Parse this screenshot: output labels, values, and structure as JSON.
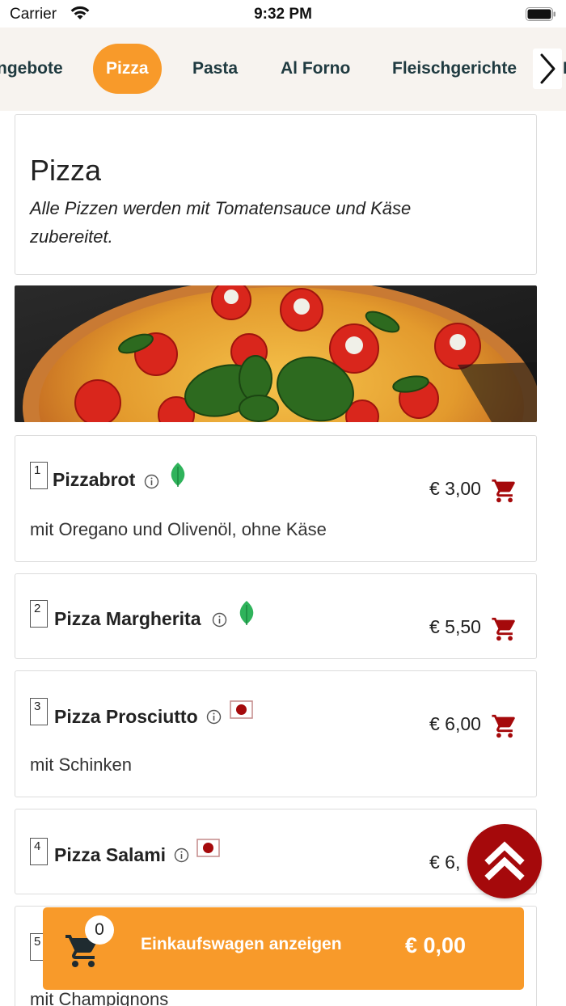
{
  "status_bar": {
    "carrier": "Carrier",
    "time": "9:32 PM"
  },
  "categories": [
    "ngebote",
    "Pizza",
    "Pasta",
    "Al Forno",
    "Fleischgerichte"
  ],
  "category_peek": "I",
  "active_category": "Pizza",
  "section": {
    "title": "Pizza",
    "description": "Alle Pizzen werden mit Tomatensauce und Käse zubereitet."
  },
  "items": [
    {
      "number": "1",
      "name": "Pizzabrot",
      "price": "€ 3,00",
      "description": "mit Oregano und Olivenöl, ohne Käse",
      "badge": "vegetarian-leaf-icon"
    },
    {
      "number": "2",
      "name": "Pizza Margherita",
      "price": "€ 5,50",
      "description": "",
      "badge": "vegetarian-leaf-icon"
    },
    {
      "number": "3",
      "name": "Pizza Prosciutto",
      "price": "€ 6,00",
      "description": "mit Schinken",
      "badge": "meat-icon"
    },
    {
      "number": "4",
      "name": "Pizza Salami",
      "price": "€ 6,",
      "description": "",
      "badge": "meat-icon"
    },
    {
      "number": "5",
      "name": "",
      "price": "",
      "description": "mit Champignons",
      "badge": ""
    }
  ],
  "cart": {
    "count": "0",
    "label": "Einkaufswagen anzeigen",
    "total": "€ 0,00"
  },
  "colors": {
    "accent": "#f89a2a",
    "cart_icon": "#a5090b",
    "nav_text": "#1f3a40",
    "veg_badge": "#2fb35b",
    "meat_badge": "#a5090b"
  }
}
